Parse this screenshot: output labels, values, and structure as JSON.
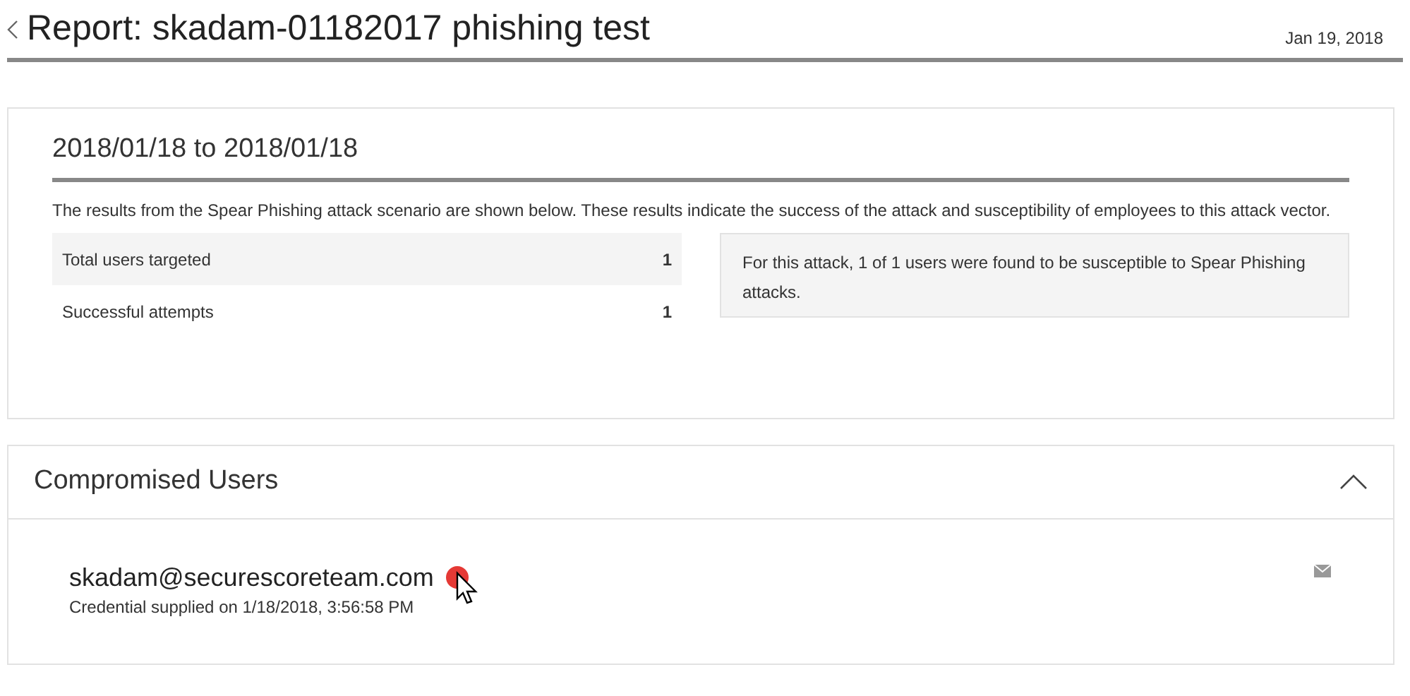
{
  "header": {
    "title": "Report: skadam-01182017 phishing test",
    "date": "Jan 19, 2018"
  },
  "summary": {
    "date_range": "2018/01/18 to 2018/01/18",
    "description": "The results from the Spear Phishing attack scenario are shown below. These results indicate the success of the attack and susceptibility of employees to this attack vector.",
    "stats": [
      {
        "label": "Total users targeted",
        "value": "1"
      },
      {
        "label": "Successful attempts",
        "value": "1"
      }
    ],
    "note": "For this attack, 1 of 1 users were found to be susceptible to Spear Phishing attacks."
  },
  "compromised": {
    "title": "Compromised Users",
    "expanded": true,
    "users": [
      {
        "email": "skadam@securescoreteam.com",
        "detail": "Credential supplied on 1/18/2018, 3:56:58 PM"
      }
    ]
  }
}
